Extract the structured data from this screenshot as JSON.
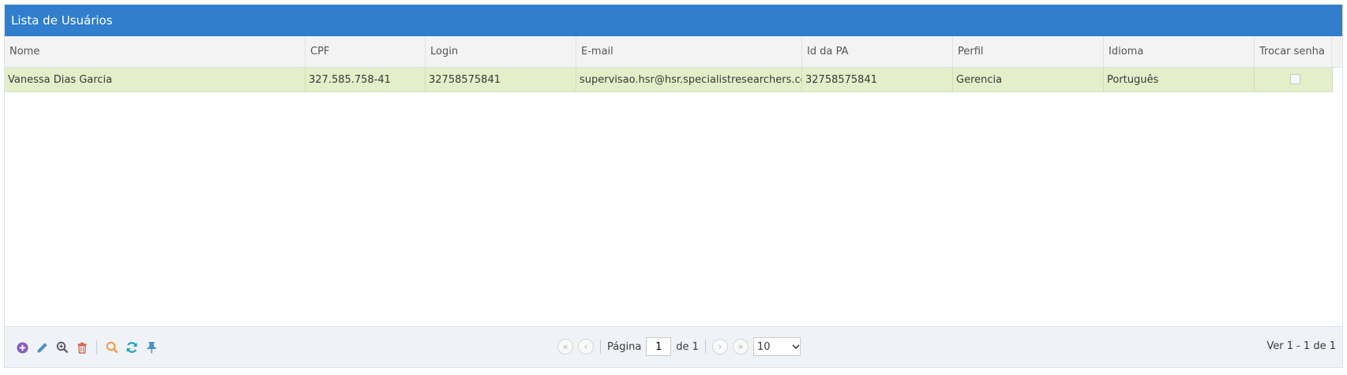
{
  "grid": {
    "title": "Lista de Usuários",
    "columns": [
      "Nome",
      "CPF",
      "Login",
      "E-mail",
      "Id da PA",
      "Perfil",
      "Idioma",
      "Trocar senha"
    ],
    "rows": [
      {
        "nome": "Vanessa Dias Garcia",
        "cpf": "327.585.758-41",
        "login": "32758575841",
        "email": "supervisao.hsr@hsr.specialistresearchers.com",
        "id_pa": "32758575841",
        "perfil": "Gerencia",
        "idioma": "Português",
        "trocar_senha": false
      }
    ]
  },
  "pager": {
    "actions": [
      "add-icon",
      "edit-icon",
      "view-icon",
      "delete-icon",
      "search-icon",
      "refresh-icon",
      "pin-icon"
    ],
    "page_label": "Página",
    "page_value": "1",
    "of_label": "de 1",
    "rows_per_page": "10",
    "record_info": "Ver 1 - 1 de 1"
  },
  "colors": {
    "title_bar": "#307ecc",
    "selected_row": "#e4efc9",
    "add": "#8a5bbf",
    "edit": "#478fca",
    "delete": "#d15b47",
    "search": "#f59942",
    "refresh": "#1fa3b5",
    "pin": "#478fca"
  }
}
